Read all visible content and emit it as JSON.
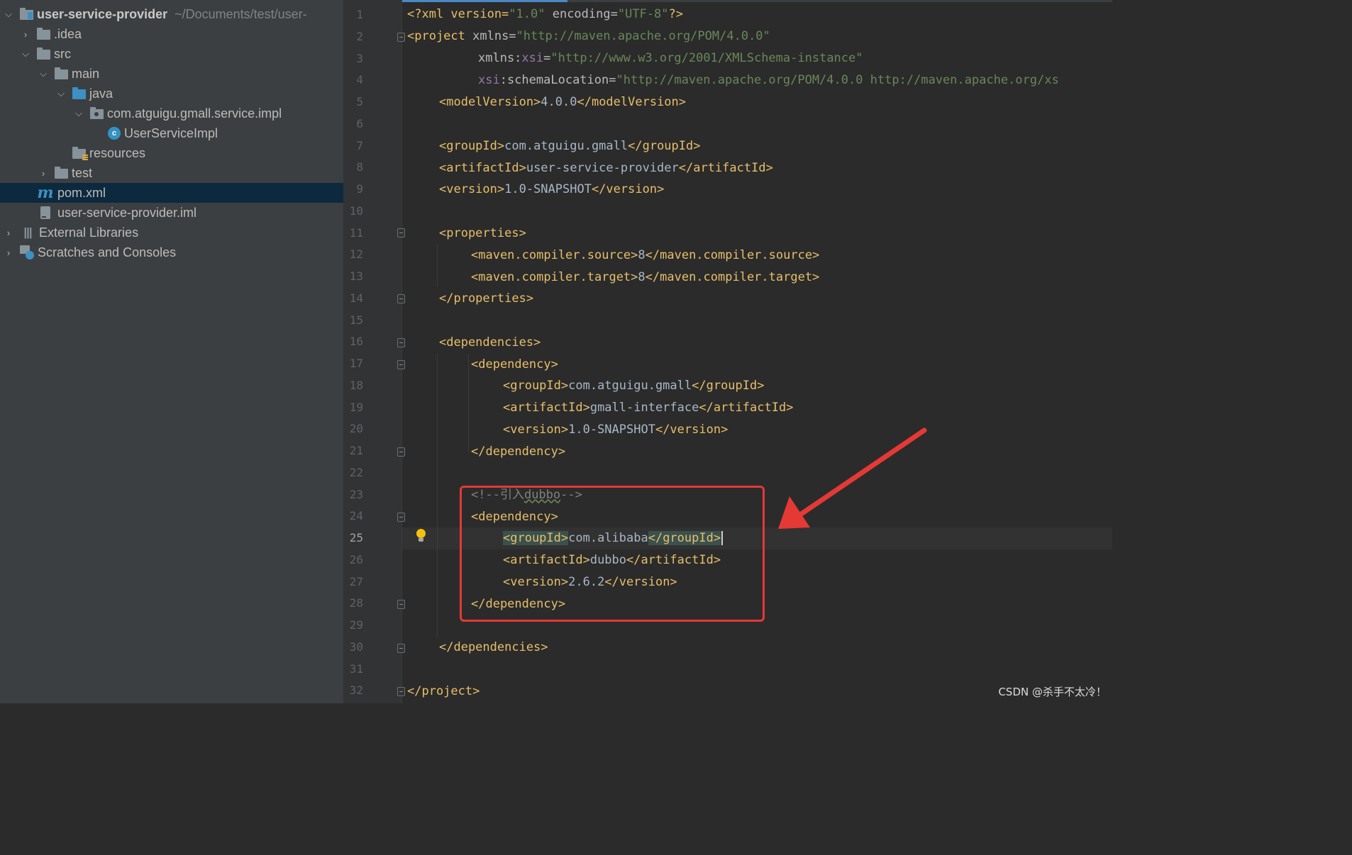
{
  "project_tree": {
    "root": {
      "name": "user-service-provider",
      "path": "~/Documents/test/user-"
    },
    "items": [
      {
        "label": ".idea",
        "icon": "folder-icon"
      },
      {
        "label": "src",
        "icon": "folder-icon"
      },
      {
        "label": "main",
        "icon": "folder-icon"
      },
      {
        "label": "java",
        "icon": "source-folder-icon"
      },
      {
        "label": "com.atguigu.gmall.service.impl",
        "icon": "package-icon"
      },
      {
        "label": "UserServiceImpl",
        "icon": "class-icon",
        "glyph": "c"
      },
      {
        "label": "resources",
        "icon": "resources-folder-icon"
      },
      {
        "label": "test",
        "icon": "folder-icon"
      },
      {
        "label": "pom.xml",
        "icon": "maven-icon",
        "glyph": "m"
      },
      {
        "label": "user-service-provider.iml",
        "icon": "iml-file-icon"
      },
      {
        "label": "External Libraries",
        "icon": "libraries-icon"
      },
      {
        "label": "Scratches and Consoles",
        "icon": "scratches-icon"
      }
    ]
  },
  "editor": {
    "file": "pom.xml",
    "current_line": 25,
    "line_numbers": [
      "1",
      "2",
      "3",
      "4",
      "5",
      "6",
      "7",
      "8",
      "9",
      "10",
      "11",
      "12",
      "13",
      "14",
      "15",
      "16",
      "17",
      "18",
      "19",
      "20",
      "21",
      "22",
      "23",
      "24",
      "25",
      "26",
      "27",
      "28",
      "29",
      "30",
      "31",
      "32"
    ],
    "code": {
      "l1_decl": "<?xml version=",
      "l1_v": "\"1.0\"",
      "l1_enc": " encoding=",
      "l1_ev": "\"UTF-8\"",
      "l1_end": "?>",
      "l2_tag": "<project ",
      "l2_attr": "xmlns=",
      "l2_val": "\"http://maven.apache.org/POM/4.0.0\"",
      "l3_attr": "xmlns:",
      "l3_ns": "xsi",
      "l3_eq": "=",
      "l3_val": "\"http://www.w3.org/2001/XMLSchema-instance\"",
      "l4_ns": "xsi",
      "l4_attr": ":schemaLocation=",
      "l4_val": "\"http://maven.apache.org/POM/4.0.0 http://maven.apache.org/xs",
      "l5_open": "<modelVersion>",
      "l5_text": "4.0.0",
      "l5_close": "</modelVersion>",
      "l7_open": "<groupId>",
      "l7_text": "com.atguigu.gmall",
      "l7_close": "</groupId>",
      "l8_open": "<artifactId>",
      "l8_text": "user-service-provider",
      "l8_close": "</artifactId>",
      "l9_open": "<version>",
      "l9_text": "1.0-SNAPSHOT",
      "l9_close": "</version>",
      "l11": "<properties>",
      "l12_open": "<maven.compiler.source>",
      "l12_text": "8",
      "l12_close": "</maven.compiler.source>",
      "l13_open": "<maven.compiler.target>",
      "l13_text": "8",
      "l13_close": "</maven.compiler.target>",
      "l14": "</properties>",
      "l16": "<dependencies>",
      "l17": "<dependency>",
      "l18_open": "<groupId>",
      "l18_text": "com.atguigu.gmall",
      "l18_close": "</groupId>",
      "l19_open": "<artifactId>",
      "l19_text": "gmall-interface",
      "l19_close": "</artifactId>",
      "l20_open": "<version>",
      "l20_text": "1.0-SNAPSHOT",
      "l20_close": "</version>",
      "l21": "</dependency>",
      "l23_a": "<!--引入",
      "l23_b": "dubbo",
      "l23_c": "-->",
      "l24": "<dependency>",
      "l25_open": "<groupId>",
      "l25_text": "com.alibaba",
      "l25_close": "</groupId>",
      "l26_open": "<artifactId>",
      "l26_text": "dubbo",
      "l26_close": "</artifactId>",
      "l27_open": "<version>",
      "l27_text": "2.6.2",
      "l27_close": "</version>",
      "l28": "</dependency>",
      "l30": "</dependencies>",
      "l32": "</project>"
    }
  },
  "colors": {
    "sidebar_bg": "#3c3f41",
    "editor_bg": "#2b2b2b",
    "tag": "#e8bf6a",
    "string": "#6a8759",
    "namespace": "#9876aa",
    "comment": "#808080",
    "annotation": "#e53935"
  },
  "watermark": "CSDN @杀手不太冷！"
}
